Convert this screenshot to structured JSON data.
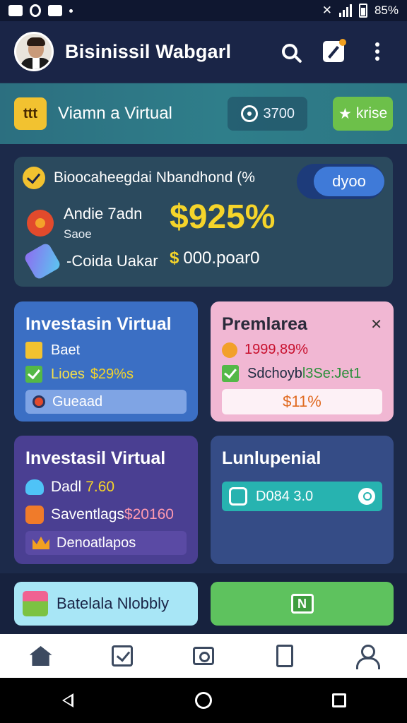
{
  "status_bar": {
    "battery_text": "85%"
  },
  "header": {
    "title": "Bisinissil Wabgarl",
    "icons": [
      "search-icon",
      "edit-tool-icon",
      "more-vert-icon"
    ]
  },
  "banner": {
    "logo_text": "ttt",
    "title": "Viamn a Virtual",
    "chip_value": "3700",
    "button_label": "krise"
  },
  "summary": {
    "heading": "Bioocaheegdai Nbandhond (%",
    "toggle_label": "dyoo",
    "person_name": "Andie 7adn",
    "person_sub": "Saoe",
    "big_value": "$925%",
    "row3_label": "-Coida Uakar",
    "row3_value_symbol": "$",
    "row3_value": "000.poar0"
  },
  "cards": {
    "blue": {
      "title": "Investasin Virtual",
      "line1": "Baet",
      "line2_label": "Lioes",
      "line2_value": "$29%s",
      "input_value": "Gueaad"
    },
    "pink": {
      "title": "Premlarea",
      "line1": "1999,89%",
      "line2_label": "Sdchoyb",
      "line2_value": "l3Se:Jet1",
      "box_value": "$11%"
    },
    "purple": {
      "title": "Investasil Virtual",
      "line1_label": "Dadl",
      "line1_value": "7.60",
      "line2_label": "Saventlags",
      "line2_value": "$20160",
      "bar_label": "Denoatlapos"
    },
    "navy": {
      "title": "Lunlupenial",
      "bar_value": "D084 3.0"
    }
  },
  "actions": {
    "left_label": "Batelala Nlobbly",
    "right_icon_text": "N"
  },
  "nav": {
    "items": [
      "home-icon",
      "tasks-icon",
      "camera-icon",
      "document-icon",
      "profile-icon"
    ]
  },
  "colors": {
    "background": "#1c2a4a",
    "banner": "#2f7e8a",
    "accent_green": "#6dc04a",
    "accent_yellow": "#f5d42a",
    "card_blue": "#3b6fc4",
    "card_pink": "#f1b7d3",
    "card_purple": "#4a3f92",
    "card_navy": "#354c86"
  }
}
